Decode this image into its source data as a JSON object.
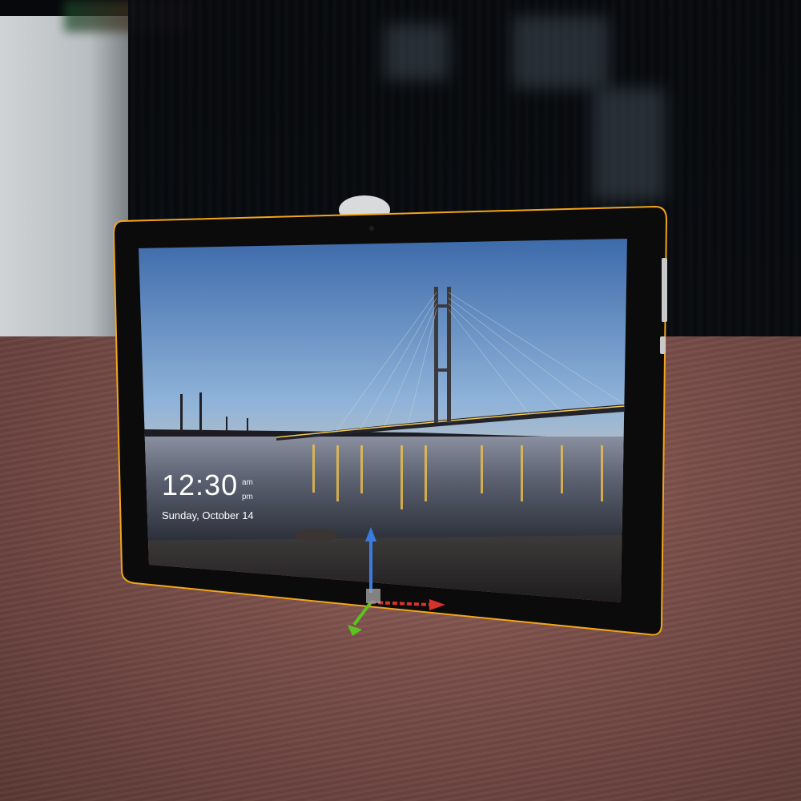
{
  "lock_screen": {
    "time": "12:30",
    "am": "am",
    "pm": "pm",
    "date": "Sunday, October 14"
  },
  "colors": {
    "selection_outline": "#f2a51c",
    "gizmo_x": "#d8322c",
    "gizmo_y": "#3a7be0",
    "gizmo_z": "#5cc31f"
  },
  "icons": {
    "transform_gizmo": "move-gizmo-icon"
  }
}
